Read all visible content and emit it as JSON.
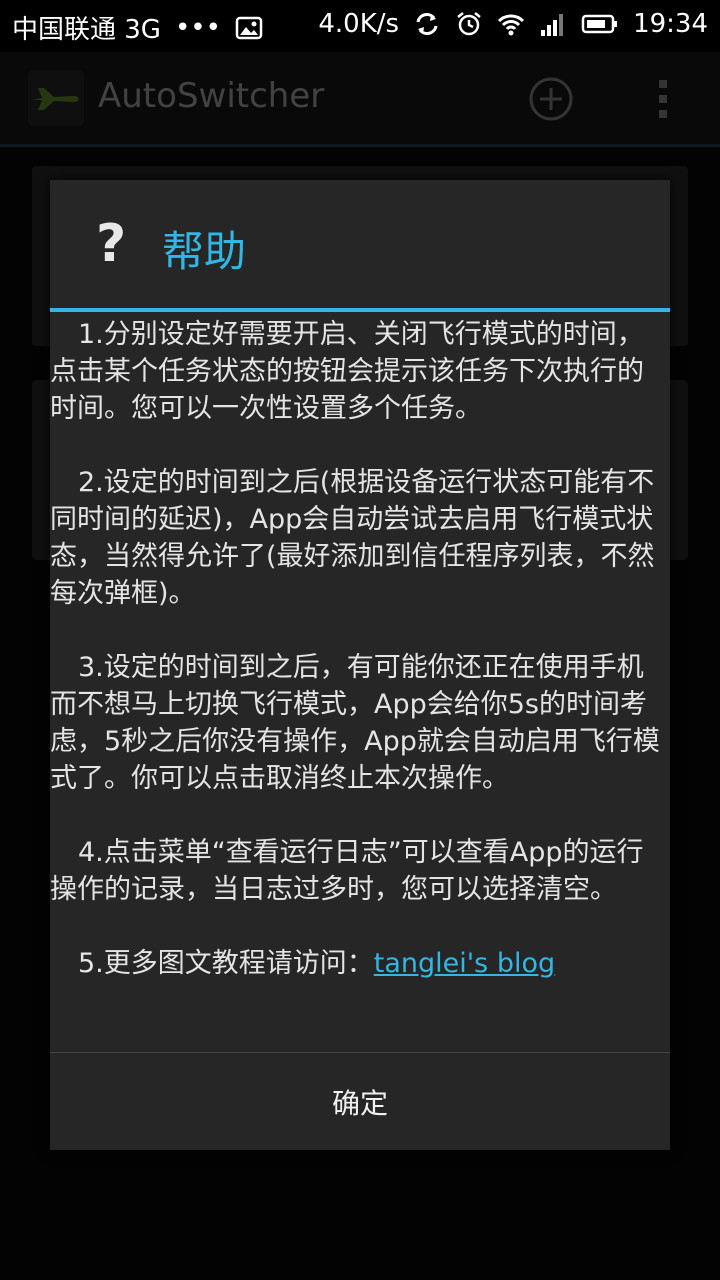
{
  "status_bar": {
    "carrier": "中国联通 3G",
    "dots": "•••",
    "speed": "4.0K/s",
    "time": "19:34"
  },
  "action_bar": {
    "title": "AutoSwitcher"
  },
  "dialog": {
    "title": "帮助",
    "paragraphs": [
      "1.分别设定好需要开启、关闭飞行模式的时间，点击某个任务状态的按钮会提示该任务下次执行的时间。您可以一次性设置多个任务。",
      "2.设定的时间到之后(根据设备运行状态可能有不同时间的延迟)，App会自动尝试去启用飞行模式状态，当然得允许了(最好添加到信任程序列表，不然每次弹框)。",
      "3.设定的时间到之后，有可能你还正在使用手机而不想马上切换飞行模式，App会给你5s的时间考虑，5秒之后你没有操作，App就会自动启用飞行模式了。你可以点击取消终止本次操作。",
      "4.点击菜单“查看运行日志”可以查看App的运行操作的记录，当日志过多时，您可以选择清空。"
    ],
    "p5_prefix": "5.更多图文教程请访问：",
    "p5_link": "tanglei's blog",
    "ok_label": "确定"
  },
  "colors": {
    "accent": "#33b5e5"
  }
}
